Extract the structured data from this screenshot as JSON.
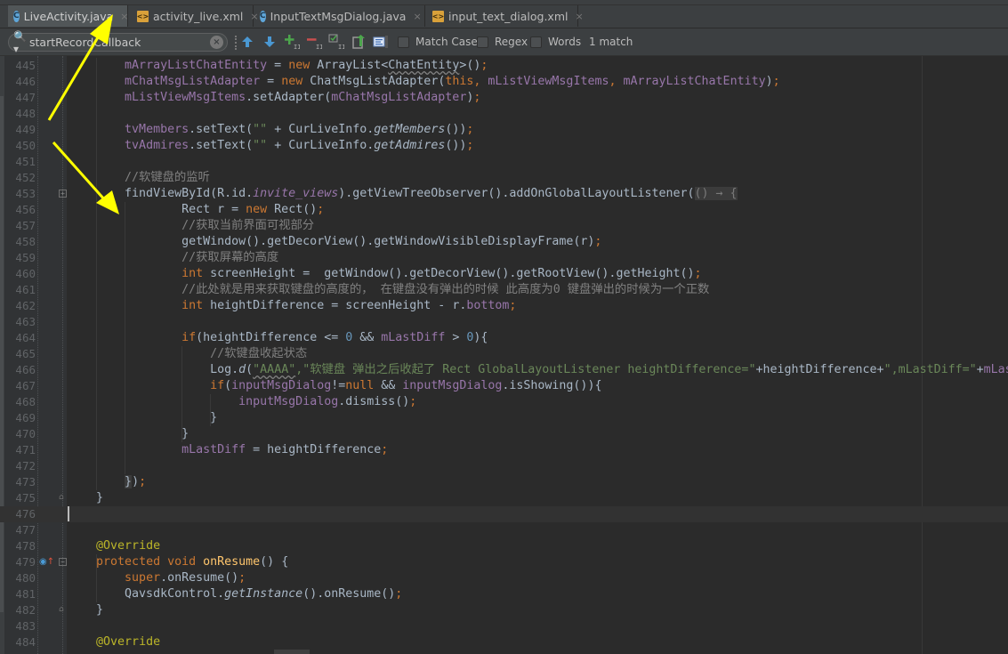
{
  "tabs": [
    {
      "label": "LiveActivity.java",
      "type": "java",
      "active": true
    },
    {
      "label": "activity_live.xml",
      "type": "xml",
      "active": false
    },
    {
      "label": "InputTextMsgDialog.java",
      "type": "java",
      "active": false
    },
    {
      "label": "input_text_dialog.xml",
      "type": "xml",
      "active": false
    }
  ],
  "icons": {
    "java": "C",
    "xml": "<>",
    "close": "×",
    "search": "🔍▾",
    "clear": "×",
    "expand": "+",
    "collapse": "−"
  },
  "search": {
    "value": "startRecordCallback",
    "match_case_label": "Match Case",
    "regex_label": "Regex",
    "words_label": "Words",
    "match_case_checked": false,
    "regex_checked": false,
    "words_checked": false,
    "match_count": "1 match",
    "toolbar_icons": [
      "previous-occurrence-icon",
      "next-occurrence-icon",
      "add-selection-icon",
      "remove-selection-icon",
      "select-all-occurrences-icon",
      "export-icon",
      "filter-search-results-icon"
    ]
  },
  "editor": {
    "current_line": "476",
    "lines": [
      {
        "n": "445",
        "html_key": "l445"
      },
      {
        "n": "446",
        "html_key": "l446"
      },
      {
        "n": "447",
        "html_key": "l447"
      },
      {
        "n": "448",
        "html_key": "l448"
      },
      {
        "n": "449",
        "html_key": "l449"
      },
      {
        "n": "450",
        "html_key": "l450"
      },
      {
        "n": "451",
        "html_key": "l451"
      },
      {
        "n": "452",
        "html_key": "l452"
      },
      {
        "n": "453",
        "html_key": "l453"
      },
      {
        "n": "456",
        "html_key": "l456"
      },
      {
        "n": "457",
        "html_key": "l457"
      },
      {
        "n": "458",
        "html_key": "l458"
      },
      {
        "n": "459",
        "html_key": "l459"
      },
      {
        "n": "460",
        "html_key": "l460"
      },
      {
        "n": "461",
        "html_key": "l461"
      },
      {
        "n": "462",
        "html_key": "l462"
      },
      {
        "n": "463",
        "html_key": "l463"
      },
      {
        "n": "464",
        "html_key": "l464"
      },
      {
        "n": "465",
        "html_key": "l465"
      },
      {
        "n": "466",
        "html_key": "l466"
      },
      {
        "n": "467",
        "html_key": "l467"
      },
      {
        "n": "468",
        "html_key": "l468"
      },
      {
        "n": "469",
        "html_key": "l469"
      },
      {
        "n": "470",
        "html_key": "l470"
      },
      {
        "n": "471",
        "html_key": "l471"
      },
      {
        "n": "472",
        "html_key": "l472"
      },
      {
        "n": "473",
        "html_key": "l473"
      },
      {
        "n": "475",
        "html_key": "l475"
      },
      {
        "n": "476",
        "html_key": "l476"
      },
      {
        "n": "477",
        "html_key": "l477"
      },
      {
        "n": "478",
        "html_key": "l478"
      },
      {
        "n": "479",
        "html_key": "l479"
      },
      {
        "n": "480",
        "html_key": "l480"
      },
      {
        "n": "481",
        "html_key": "l481"
      },
      {
        "n": "482",
        "html_key": "l482"
      },
      {
        "n": "483",
        "html_key": "l483"
      },
      {
        "n": "484",
        "html_key": "l484"
      }
    ],
    "code": {
      "l445": [
        [
          "",
          "        "
        ],
        [
          "fld",
          "mArrayListChatEntity"
        ],
        [
          "",
          " = "
        ],
        [
          "kw",
          "new"
        ],
        [
          "",
          " ArrayList<"
        ],
        [
          "wavy",
          "ChatEntity"
        ],
        [
          "",
          ">()"
        ],
        [
          "kw",
          ";"
        ]
      ],
      "l446": [
        [
          "",
          "        "
        ],
        [
          "fld",
          "mChatMsgListAdapter"
        ],
        [
          "",
          " = "
        ],
        [
          "kw",
          "new"
        ],
        [
          "",
          " ChatMsgListAdapter("
        ],
        [
          "kw",
          "this, "
        ],
        [
          "fld",
          "mListViewMsgItems"
        ],
        [
          "kw",
          ", "
        ],
        [
          "fld",
          "mArrayListChatEntity"
        ],
        [
          "",
          ")"
        ],
        [
          "kw",
          ";"
        ]
      ],
      "l447": [
        [
          "",
          "        "
        ],
        [
          "fld",
          "mListViewMsgItems"
        ],
        [
          "",
          ".setAdapter("
        ],
        [
          "fld",
          "mChatMsgListAdapter"
        ],
        [
          "",
          ")"
        ],
        [
          "kw",
          ";"
        ]
      ],
      "l448": [],
      "l449": [
        [
          "",
          "        "
        ],
        [
          "fld",
          "tvMembers"
        ],
        [
          "",
          ".setText("
        ],
        [
          "str",
          "\"\""
        ],
        [
          "",
          " + CurLiveInfo."
        ],
        [
          "ita",
          "getMembers"
        ],
        [
          "",
          "())"
        ],
        [
          "kw",
          ";"
        ]
      ],
      "l450": [
        [
          "",
          "        "
        ],
        [
          "fld",
          "tvAdmires"
        ],
        [
          "",
          ".setText("
        ],
        [
          "str",
          "\"\""
        ],
        [
          "",
          " + CurLiveInfo."
        ],
        [
          "ita",
          "getAdmires"
        ],
        [
          "",
          "())"
        ],
        [
          "kw",
          ";"
        ]
      ],
      "l451": [],
      "l452": [
        [
          "",
          "        "
        ],
        [
          "cmt",
          "//软键盘的监听"
        ]
      ],
      "l453": [
        [
          "",
          "        findViewById(R.id."
        ],
        [
          "fld ita",
          "invite_views"
        ],
        [
          "",
          ").getViewTreeObserver().addOnGlobalLayoutListener("
        ],
        [
          "lambda-hint",
          "() → {"
        ]
      ],
      "l456": [
        [
          "",
          "                Rect r = "
        ],
        [
          "kw",
          "new"
        ],
        [
          "",
          " Rect()"
        ],
        [
          "kw",
          ";"
        ]
      ],
      "l457": [
        [
          "",
          "                "
        ],
        [
          "cmt",
          "//获取当前界面可视部分"
        ]
      ],
      "l458": [
        [
          "",
          "                getWindow().getDecorView().getWindowVisibleDisplayFrame(r)"
        ],
        [
          "kw",
          ";"
        ]
      ],
      "l459": [
        [
          "",
          "                "
        ],
        [
          "cmt",
          "//获取屏幕的高度"
        ]
      ],
      "l460": [
        [
          "",
          "                "
        ],
        [
          "kw",
          "int"
        ],
        [
          "",
          " screenHeight =  getWindow().getDecorView().getRootView().getHeight()"
        ],
        [
          "kw",
          ";"
        ]
      ],
      "l461": [
        [
          "",
          "                "
        ],
        [
          "cmt",
          "//此处就是用来获取键盘的高度的， 在键盘没有弹出的时候 此高度为0 键盘弹出的时候为一个正数"
        ]
      ],
      "l462": [
        [
          "",
          "                "
        ],
        [
          "kw",
          "int"
        ],
        [
          "",
          " heightDifference = screenHeight - r."
        ],
        [
          "fld",
          "bottom"
        ],
        [
          "kw",
          ";"
        ]
      ],
      "l463": [],
      "l464": [
        [
          "",
          "                "
        ],
        [
          "kw",
          "if"
        ],
        [
          "",
          "(heightDifference <= "
        ],
        [
          "num",
          "0"
        ],
        [
          "",
          " && "
        ],
        [
          "fld",
          "mLastDiff"
        ],
        [
          "",
          " > "
        ],
        [
          "num",
          "0"
        ],
        [
          "",
          "){"
        ]
      ],
      "l465": [
        [
          "",
          "                    "
        ],
        [
          "cmt",
          "//软键盘收起状态"
        ]
      ],
      "l466": [
        [
          "",
          "                    Log."
        ],
        [
          "ita",
          "d"
        ],
        [
          "",
          "("
        ],
        [
          "str wavy",
          "\"AAAA\""
        ],
        [
          "str",
          ",\"软键盘 弹出之后收起了 Rect GlobalLayoutListener heightDifference=\""
        ],
        [
          "",
          "+heightDifference+"
        ],
        [
          "str",
          "\",mLastDiff=\""
        ],
        [
          "",
          "+"
        ],
        [
          "fld",
          "mLastDiff"
        ]
      ],
      "l467": [
        [
          "",
          "                    "
        ],
        [
          "kw",
          "if"
        ],
        [
          "",
          "("
        ],
        [
          "fld",
          "inputMsgDialog"
        ],
        [
          "",
          "!="
        ],
        [
          "kw",
          "null"
        ],
        [
          "",
          " && "
        ],
        [
          "fld",
          "inputMsgDialog"
        ],
        [
          "",
          ".isShowing()){"
        ]
      ],
      "l468": [
        [
          "",
          "                        "
        ],
        [
          "fld",
          "inputMsgDialog"
        ],
        [
          "",
          ".dismiss()"
        ],
        [
          "kw",
          ";"
        ]
      ],
      "l469": [
        [
          "",
          "                    }"
        ]
      ],
      "l470": [
        [
          "",
          "                }"
        ]
      ],
      "l471": [
        [
          "",
          "                "
        ],
        [
          "fld",
          "mLastDiff"
        ],
        [
          "",
          " = heightDifference"
        ],
        [
          "kw",
          ";"
        ]
      ],
      "l472": [],
      "l473": [
        [
          "",
          "        "
        ],
        [
          "bracehl",
          "}"
        ],
        [
          "",
          ")"
        ],
        [
          "kw",
          ";"
        ]
      ],
      "l475": [
        [
          "",
          "    }"
        ]
      ],
      "l476": [],
      "l477": [],
      "l478": [
        [
          "",
          "    "
        ],
        [
          "ann",
          "@Override"
        ]
      ],
      "l479": [
        [
          "",
          "    "
        ],
        [
          "kw",
          "protected void "
        ],
        [
          "mth",
          "onResume"
        ],
        [
          "",
          "() {"
        ]
      ],
      "l480": [
        [
          "",
          "        "
        ],
        [
          "kw",
          "super"
        ],
        [
          "",
          ".onResume()"
        ],
        [
          "kw",
          ";"
        ]
      ],
      "l481": [
        [
          "",
          "        QavsdkControl."
        ],
        [
          "ita",
          "getInstance"
        ],
        [
          "",
          "().onResume()"
        ],
        [
          "kw",
          ";"
        ]
      ],
      "l482": [
        [
          "",
          "    }"
        ]
      ],
      "l483": [],
      "l484": [
        [
          "",
          "    "
        ],
        [
          "ann",
          "@Override"
        ]
      ]
    },
    "fold_markers": {
      "453": "expand",
      "475": "end",
      "479": "collapse",
      "482": "end"
    },
    "gutter_icons": {
      "479": "override-method-icon"
    }
  },
  "colors": {
    "background": "#2b2b2b",
    "keyword": "#cc7832",
    "field": "#9876aa",
    "string": "#6a8759",
    "comment": "#808080",
    "number": "#6897bb",
    "annotation": "#bbb529",
    "method_decl": "#ffc66d",
    "annotation_arrow": "#ffff00"
  }
}
